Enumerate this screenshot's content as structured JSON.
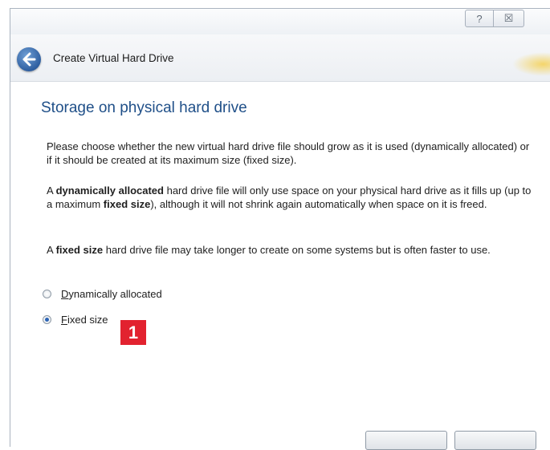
{
  "window": {
    "help_glyph": "?",
    "close_glyph": "☒"
  },
  "header": {
    "title": "Create Virtual Hard Drive",
    "back_icon": "back-arrow-icon"
  },
  "page": {
    "title": "Storage on physical hard drive",
    "para1": "Please choose whether the new virtual hard drive file should grow as it is used (dynamically allocated) or if it should be created at its maximum size (fixed size).",
    "para2": {
      "t1": "A ",
      "b1": "dynamically allocated",
      "t2": " hard drive file will only use space on your physical hard drive as it fills up (up to a maximum ",
      "b2": "fixed size",
      "t3": "), although it will not shrink again automatically when space on it is freed."
    },
    "para3": {
      "t1": "A ",
      "b1": "fixed size",
      "t2": " hard drive file may take longer to create on some systems but is often faster to use."
    }
  },
  "options": [
    {
      "mnemonic": "D",
      "rest": "ynamically allocated",
      "selected": false
    },
    {
      "mnemonic": "F",
      "rest": "ixed size",
      "selected": true
    }
  ],
  "annotation": {
    "badge": "1",
    "color": "#e2222f"
  }
}
